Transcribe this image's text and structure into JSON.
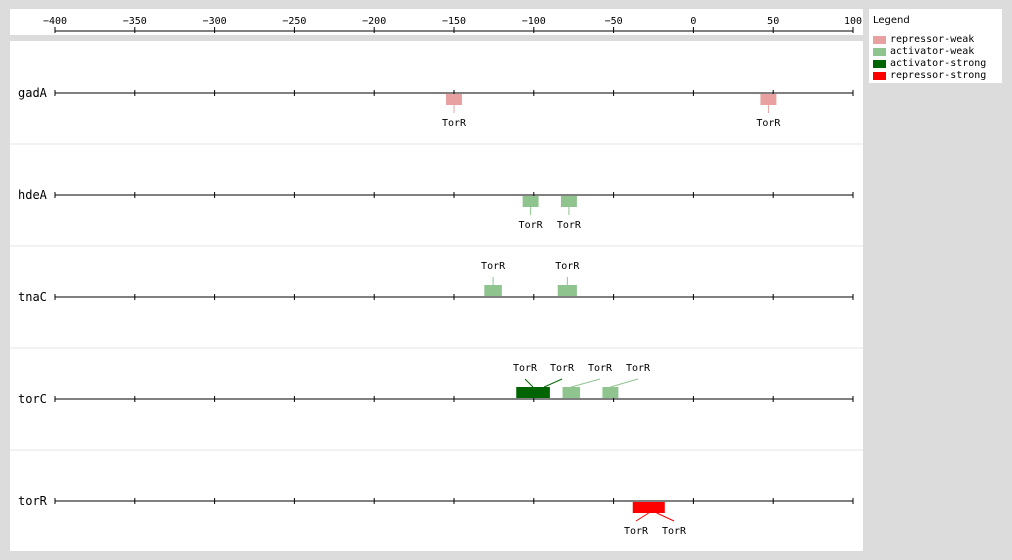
{
  "axis": {
    "min": -400,
    "max": 100,
    "ticks": [
      -400,
      -350,
      -300,
      -250,
      -200,
      -150,
      -100,
      -50,
      0,
      50,
      100
    ],
    "tick_labels": [
      "−400",
      "−350",
      "−300",
      "−250",
      "−200",
      "−150",
      "−100",
      "−50",
      "0",
      "50",
      "100"
    ]
  },
  "legend": {
    "title": "Legend",
    "items": [
      {
        "key": "repressor-weak",
        "label": "repressor-weak",
        "color": "#e8a0a0"
      },
      {
        "key": "activator-weak",
        "label": "activator-weak",
        "color": "#8fc48f"
      },
      {
        "key": "activator-strong",
        "label": "activator-strong",
        "color": "#006400"
      },
      {
        "key": "repressor-strong",
        "label": "repressor-strong",
        "color": "#ff0000"
      }
    ]
  },
  "tracks": [
    {
      "gene": "gadA",
      "sites": [
        {
          "start": -155,
          "end": -145,
          "type": "repressor-weak",
          "strand": "-",
          "label": "TorR"
        },
        {
          "start": 42,
          "end": 52,
          "type": "repressor-weak",
          "strand": "-",
          "label": "TorR"
        }
      ]
    },
    {
      "gene": "hdeA",
      "sites": [
        {
          "start": -107,
          "end": -97,
          "type": "activator-weak",
          "strand": "-",
          "label": "TorR"
        },
        {
          "start": -83,
          "end": -73,
          "type": "activator-weak",
          "strand": "-",
          "label": "TorR"
        }
      ]
    },
    {
      "gene": "tnaC",
      "sites": [
        {
          "start": -131,
          "end": -120,
          "type": "activator-weak",
          "strand": "+",
          "label": "TorR"
        },
        {
          "start": -85,
          "end": -73,
          "type": "activator-weak",
          "strand": "+",
          "label": "TorR"
        }
      ]
    },
    {
      "gene": "torC",
      "sites": [
        {
          "start": -111,
          "end": -90,
          "type": "activator-strong",
          "strand": "+",
          "label": "TorR"
        },
        {
          "start": -82,
          "end": -71,
          "type": "activator-weak",
          "strand": "+",
          "label": "TorR"
        },
        {
          "start": -57,
          "end": -47,
          "type": "activator-weak",
          "strand": "+",
          "label": "TorR"
        },
        {
          "start": -97,
          "end": -90,
          "type": "activator-strong",
          "strand": "+",
          "label": "TorR"
        }
      ]
    },
    {
      "gene": "torR",
      "sites": [
        {
          "start": -38,
          "end": -18,
          "type": "repressor-strong",
          "strand": "-",
          "label": "TorR"
        },
        {
          "start": -28,
          "end": -18,
          "type": "repressor-strong",
          "strand": "-",
          "label": "TorR"
        }
      ]
    }
  ]
}
